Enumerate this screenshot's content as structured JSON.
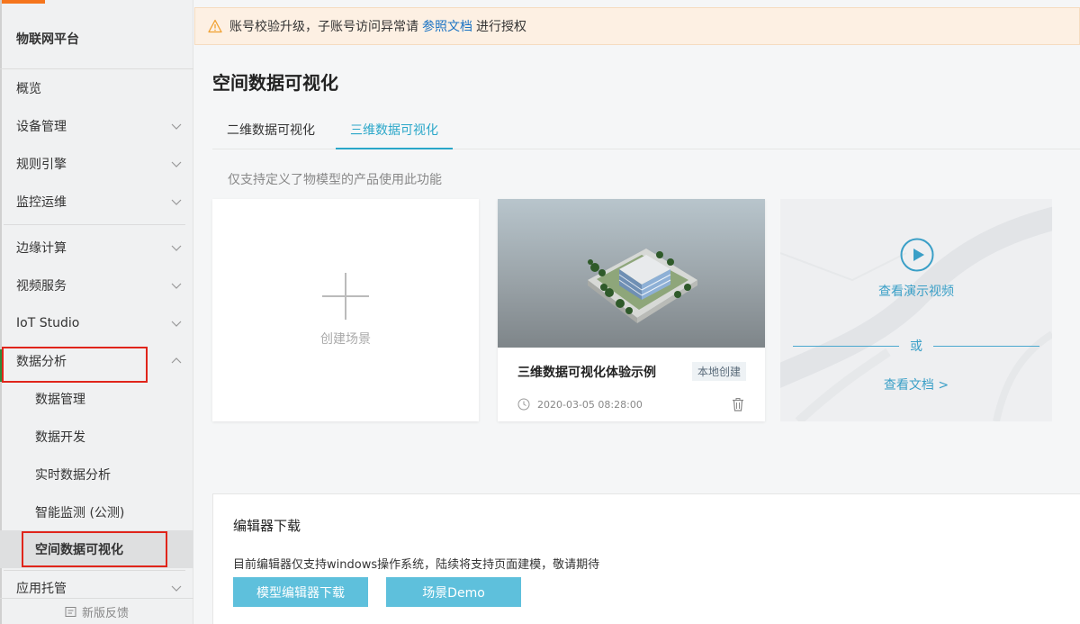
{
  "sidebar": {
    "title": "物联网平台",
    "items": [
      {
        "label": "概览"
      },
      {
        "label": "设备管理"
      },
      {
        "label": "规则引擎"
      },
      {
        "label": "监控运维"
      },
      {
        "label": "边缘计算"
      },
      {
        "label": "视频服务"
      },
      {
        "label": "IoT Studio"
      },
      {
        "label": "数据分析"
      },
      {
        "label": "应用托管"
      }
    ],
    "subitems": [
      {
        "label": "数据管理"
      },
      {
        "label": "数据开发"
      },
      {
        "label": "实时数据分析"
      },
      {
        "label": "智能监测 (公测)"
      },
      {
        "label": "空间数据可视化"
      }
    ],
    "feedback": "新版反馈"
  },
  "notice": {
    "text_before": "账号校验升级，子账号访问异常请",
    "link": "参照文档",
    "text_after": "进行授权"
  },
  "page": {
    "title": "空间数据可视化",
    "tabs": [
      {
        "label": "二维数据可视化"
      },
      {
        "label": "三维数据可视化"
      }
    ],
    "hint": "仅支持定义了物模型的产品使用此功能"
  },
  "create_card": {
    "label": "创建场景"
  },
  "scene_card": {
    "name": "三维数据可视化体验示例",
    "badge": "本地创建",
    "time": "2020-03-05 08:28:00"
  },
  "demo_card": {
    "video_link": "查看演示视频",
    "or": "或",
    "doc_link": "查看文档 >"
  },
  "editor": {
    "title": "编辑器下载",
    "desc": "目前编辑器仅支持windows操作系统，陆续将支持页面建模，敬请期待",
    "btn_download": "模型编辑器下载",
    "btn_demo": "场景Demo"
  },
  "colors": {
    "accent": "#2aa7c9",
    "button": "#5ec0dc",
    "highlight_box": "#e0251b",
    "brand_orange": "#f5751d"
  }
}
